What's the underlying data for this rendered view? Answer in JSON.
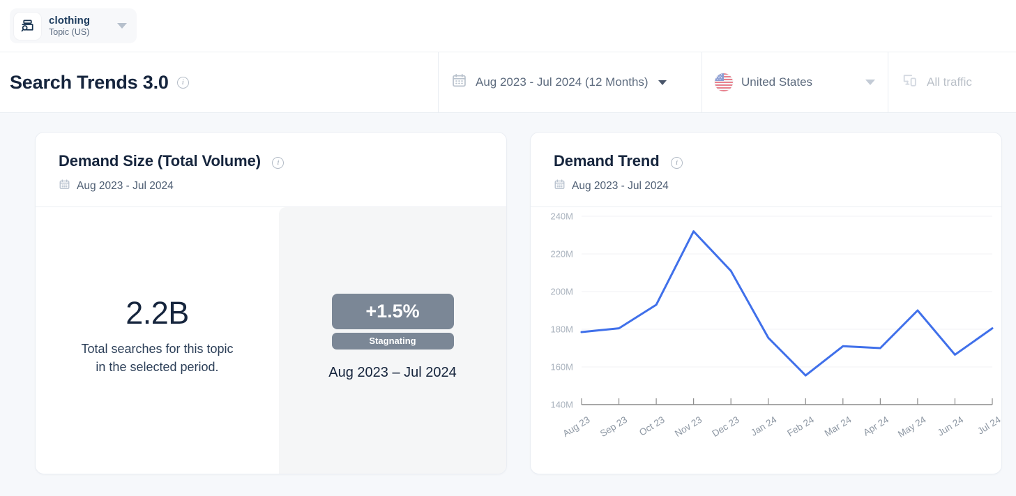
{
  "topbar": {
    "topic_icon": "search-card-icon",
    "topic_name": "clothing",
    "topic_subtitle": "Topic (US)",
    "caret_icon": "chevron-down-icon"
  },
  "header": {
    "title": "Search Trends 3.0",
    "title_info_icon": "info-icon",
    "date_range": {
      "icon": "calendar-icon",
      "label": "Aug 2023 - Jul 2024 (12 Months)",
      "caret_icon": "chevron-down-icon"
    },
    "country": {
      "icon": "us-flag-icon",
      "label": "United States",
      "caret_icon": "chevron-down-icon"
    },
    "traffic": {
      "icon": "devices-icon",
      "label": "All traffic"
    }
  },
  "demand_size_card": {
    "title": "Demand Size (Total Volume)",
    "title_info_icon": "info-icon",
    "subtitle_icon": "calendar-icon",
    "subtitle": "Aug 2023 - Jul 2024",
    "kpi_value": "2.2B",
    "kpi_caption_line1": "Total searches for this topic",
    "kpi_caption_line2": "in the selected period.",
    "growth_value": "+1.5%",
    "growth_label": "Stagnating",
    "growth_period": "Aug 2023 – Jul 2024",
    "badge_color": "#7b8796"
  },
  "demand_trend_card": {
    "title": "Demand Trend",
    "title_info_icon": "info-icon",
    "subtitle_icon": "calendar-icon",
    "subtitle": "Aug 2023 - Jul 2024"
  },
  "chart_data": {
    "type": "line",
    "title": "Demand Trend",
    "xlabel": "",
    "ylabel": "",
    "categories": [
      "Aug 23",
      "Sep 23",
      "Oct 23",
      "Nov 23",
      "Dec 23",
      "Jan 24",
      "Feb 24",
      "Mar 24",
      "Apr 24",
      "May 24",
      "Jun 24",
      "Jul 24"
    ],
    "values": [
      178500000,
      180500000,
      193000000,
      232000000,
      211000000,
      175500000,
      155500000,
      171000000,
      170000000,
      190000000,
      166500000,
      180500000
    ],
    "value_labels": [
      "178.5M",
      "180.5M",
      "193M",
      "232M",
      "211M",
      "175.5M",
      "155.5M",
      "171M",
      "170M",
      "190M",
      "166.5M",
      "180.5M"
    ],
    "yticks": [
      140000000,
      160000000,
      180000000,
      200000000,
      220000000,
      240000000
    ],
    "ytick_labels": [
      "140M",
      "160M",
      "180M",
      "200M",
      "220M",
      "240M"
    ],
    "ylim": [
      140000000,
      240000000
    ],
    "grid": true,
    "legend": "none",
    "series_color": "#4070ea",
    "line_width": 3
  }
}
